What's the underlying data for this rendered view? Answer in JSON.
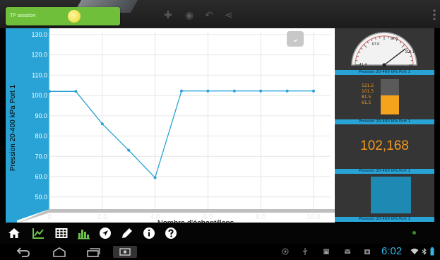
{
  "toast": {
    "label": "TP session"
  },
  "chart": {
    "chart_data": {
      "type": "line",
      "x": [
        0,
        1,
        2,
        3,
        4,
        5,
        6,
        7,
        8,
        9,
        10
      ],
      "series": [
        {
          "values": [
            102.0,
            102.0,
            86.0,
            73.0,
            59.5,
            102.2,
            102.2,
            102.2,
            102.2,
            102.2,
            102.2
          ]
        }
      ],
      "ylabel": "Pression 20-400 kPa Port 1",
      "xlabel": "Nombre d'échantillons",
      "yticks": [
        "130.0",
        "120.0",
        "110.0",
        "100.0",
        "90.0",
        "80.0",
        "70.0",
        "60.0",
        "50.0"
      ],
      "ytick_values": [
        130,
        120,
        110,
        100,
        90,
        80,
        70,
        60,
        50
      ],
      "xticks": [
        "0",
        "2.0",
        "4.0",
        "6.0",
        "8.0",
        "10.0"
      ],
      "xtick_values": [
        0,
        2,
        4,
        6,
        8,
        10
      ],
      "xlim": [
        0,
        10
      ],
      "ylim": [
        44,
        131
      ],
      "grid": true,
      "line_color": "#29a3d5"
    }
  },
  "panels": {
    "gauge": {
      "label": "Pression 20-400 kPa Port 1",
      "ticks": [
        "92.6",
        "67.0",
        "118.1",
        "41.4"
      ],
      "value": 102.168,
      "min": 41.4,
      "max": 118.1
    },
    "bar": {
      "label": "Pression 20-400 kPa Port 1",
      "levels": [
        "121.5",
        "101.5",
        "81.5",
        "61.5"
      ],
      "fill_fraction": 0.55,
      "fill_color": "#f5a21d"
    },
    "numeric": {
      "label": "Pression 20-400 kPa Port 1",
      "value": "102,168",
      "color": "#f59a1d"
    },
    "box": {
      "label": "Pression 20-400 kPa Port 1",
      "color": "#1e8ab3"
    }
  },
  "toolbar": {
    "tools": [
      {
        "name": "home-icon",
        "color": "#ffffff"
      },
      {
        "name": "line-chart-icon",
        "color": "#6cc24a"
      },
      {
        "name": "table-icon",
        "color": "#ffffff"
      },
      {
        "name": "bar-chart-icon",
        "color": "#6cc24a"
      },
      {
        "name": "navigation-icon",
        "color": "#ffffff"
      },
      {
        "name": "pen-icon",
        "color": "#ffffff"
      },
      {
        "name": "info-icon",
        "color": "#ffffff"
      },
      {
        "name": "help-icon",
        "color": "#ffffff"
      }
    ]
  },
  "system": {
    "time": "6:02",
    "nav": [
      "back-icon",
      "home-icon",
      "recent-apps-icon",
      "screenshot-icon"
    ],
    "status": [
      "target-icon",
      "usb-icon",
      "image-icon",
      "mail-icon",
      "photo-icon",
      "wifi-icon",
      "bluetooth-icon",
      "battery-icon"
    ]
  }
}
